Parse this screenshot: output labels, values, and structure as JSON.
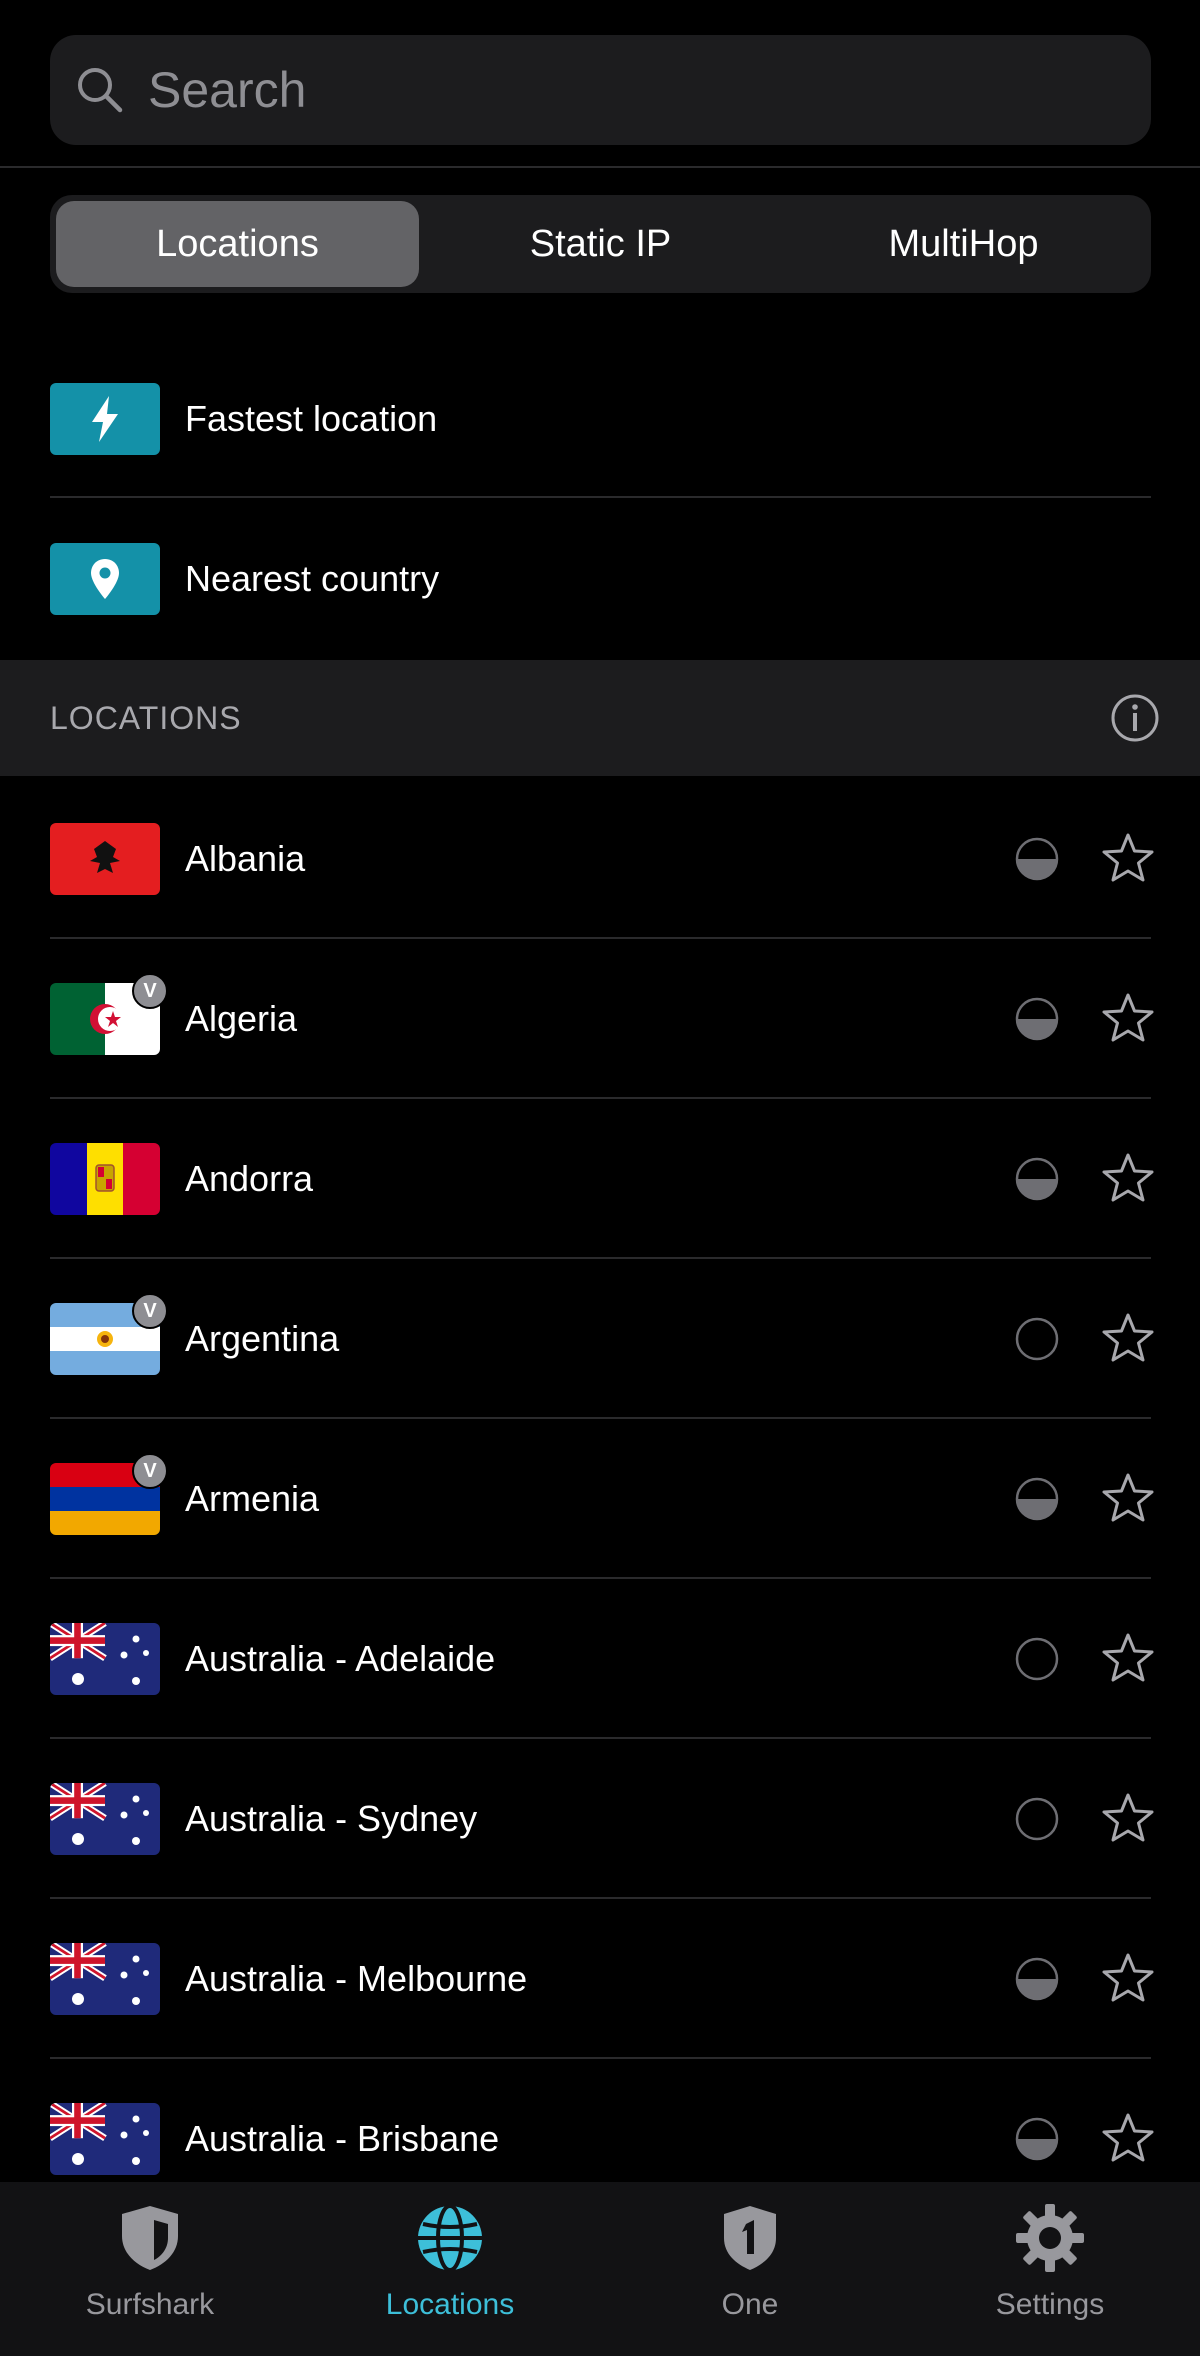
{
  "search": {
    "placeholder": "Search"
  },
  "segments": [
    {
      "label": "Locations",
      "active": true
    },
    {
      "label": "Static IP",
      "active": false
    },
    {
      "label": "MultiHop",
      "active": false
    }
  ],
  "quick": {
    "fastest": "Fastest location",
    "nearest": "Nearest country"
  },
  "section": {
    "title": "LOCATIONS"
  },
  "locations": [
    {
      "name": "Albania",
      "virtual": false,
      "flag": "albania"
    },
    {
      "name": "Algeria",
      "virtual": true,
      "virtual_badge": "V",
      "flag": "algeria"
    },
    {
      "name": "Andorra",
      "virtual": false,
      "flag": "andorra"
    },
    {
      "name": "Argentina",
      "virtual": true,
      "virtual_badge": "V",
      "flag": "argentina"
    },
    {
      "name": "Armenia",
      "virtual": true,
      "virtual_badge": "V",
      "flag": "armenia"
    },
    {
      "name": "Australia - Adelaide",
      "virtual": false,
      "flag": "australia"
    },
    {
      "name": "Australia - Sydney",
      "virtual": false,
      "flag": "australia"
    },
    {
      "name": "Australia - Melbourne",
      "virtual": false,
      "flag": "australia"
    },
    {
      "name": "Australia - Brisbane",
      "virtual": false,
      "flag": "australia"
    }
  ],
  "tabs": [
    {
      "label": "Surfshark",
      "icon": "shield-icon",
      "active": false
    },
    {
      "label": "Locations",
      "icon": "globe-icon",
      "active": true
    },
    {
      "label": "One",
      "icon": "one-shield-icon",
      "active": false
    },
    {
      "label": "Settings",
      "icon": "gear-icon",
      "active": false
    }
  ],
  "colors": {
    "accent": "#3dbfd9",
    "tile": "#1491a8",
    "background": "#000000",
    "surface": "#1c1c1e"
  }
}
